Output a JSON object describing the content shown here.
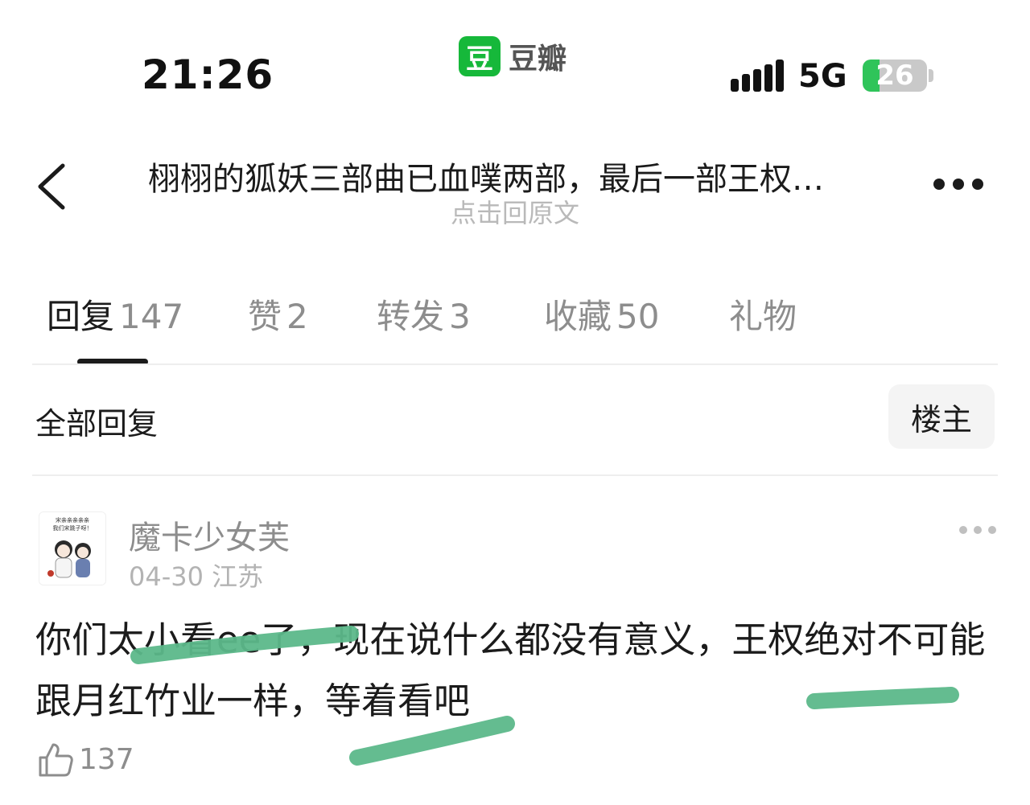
{
  "status_bar": {
    "time": "21:26",
    "app_logo_char": "豆",
    "app_name": "豆瓣",
    "network": "5G",
    "battery": "26",
    "battery_level_percent": 26
  },
  "header": {
    "title": "栩栩的狐妖三部曲已血噗两部，最后一部王权…",
    "subtitle": "点击回原文"
  },
  "tabs": [
    {
      "label": "回复",
      "count": "147",
      "active": true
    },
    {
      "label": "赞",
      "count": "2"
    },
    {
      "label": "转发",
      "count": "3"
    },
    {
      "label": "收藏",
      "count": "50"
    },
    {
      "label": "礼物",
      "count": ""
    }
  ],
  "filter": {
    "all_replies": "全部回复",
    "op_only": "楼主"
  },
  "comment": {
    "username": "魔卡少女芙",
    "date": "04-30",
    "location": "江苏",
    "text": "你们太小看ee了，现在说什么都没有意义，王权绝对不可能跟月红竹业一样，等着看吧",
    "likes": "137",
    "avatar_caption": "宋亲亲亲亲亲 我们宋跳子呀！"
  },
  "colors": {
    "brand_green": "#16b83a",
    "highlight_green": "#5cb88a",
    "text_primary": "#1b1b1b",
    "text_secondary": "#8d8d8d"
  }
}
